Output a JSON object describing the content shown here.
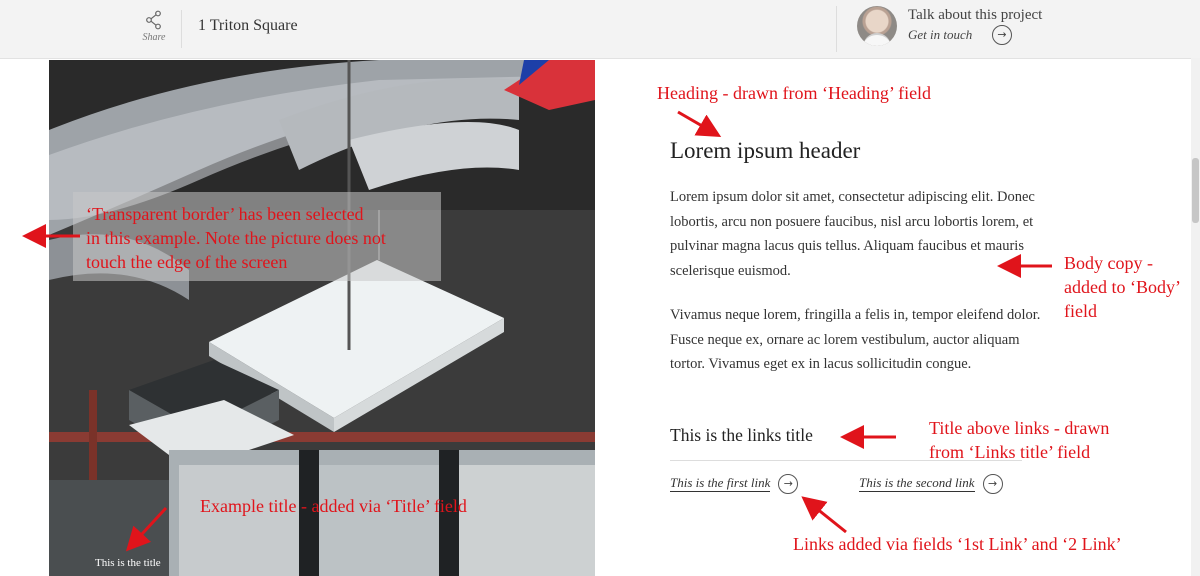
{
  "header": {
    "share_label": "Share",
    "project_title": "1 Triton Square",
    "contact_heading": "Talk about this project",
    "contact_link": "Get in touch",
    "arrow_glyph": "→"
  },
  "photo": {
    "title": "This is the title"
  },
  "content": {
    "heading": "Lorem ipsum header",
    "body_1": "Lorem ipsum dolor sit amet, consectetur adipiscing elit. Donec lobortis, arcu non posuere faucibus, nisl arcu lobortis lorem, et pulvinar magna lacus quis tellus. Aliquam faucibus et mauris scelerisque euismod.",
    "body_2": "Vivamus neque lorem, fringilla a felis in, tempor eleifend dolor. Fusce neque ex, ornare ac lorem vestibulum, auctor aliquam tortor. Vivamus eget ex in lacus sollicitudin congue.",
    "links_title": "This is the links title",
    "links": [
      {
        "label": "This is the first link"
      },
      {
        "label": "This is the second link"
      }
    ]
  },
  "annotations": {
    "heading": "Heading - drawn from ‘Heading’ field",
    "transparent_1": "‘Transparent border’ has been selected",
    "transparent_2": "in this example. Note the picture does not",
    "transparent_3": "touch the edge of the screen",
    "body_1": "Body copy -",
    "body_2": "added to ‘Body’",
    "body_3": "field",
    "links_title_1": "Title above links - drawn",
    "links_title_2": "from ‘Links title’ field",
    "example_title": "Example title - added via ‘Title’ field",
    "links_added": "Links added via fields ‘1st Link’ and ‘2 Link’"
  },
  "colors": {
    "annotation_red": "#e0141b",
    "header_bg": "#f3f3f3"
  },
  "icons": [
    "share-icon",
    "arrow-circle-icon",
    "avatar"
  ]
}
